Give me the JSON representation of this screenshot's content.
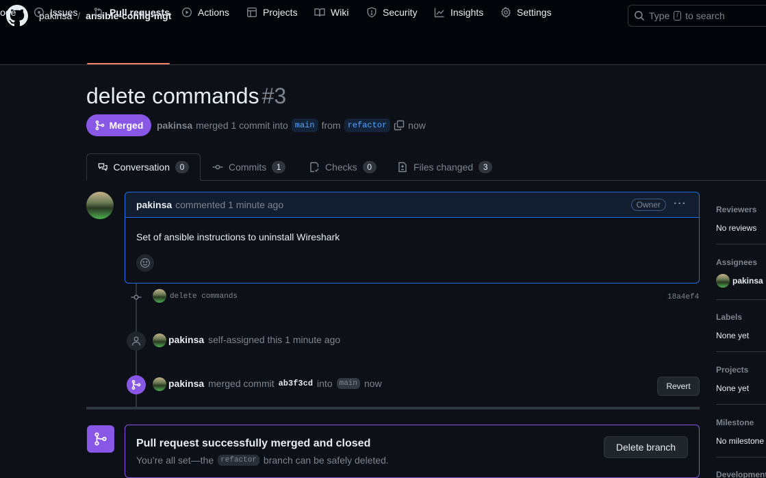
{
  "repo": {
    "owner": "pakinsa",
    "name": "ansible-config-mgt"
  },
  "search": {
    "prefix": "Type",
    "key": "/",
    "suffix": "to search"
  },
  "nav": [
    {
      "label": "Code",
      "icon": "code-icon"
    },
    {
      "label": "Issues",
      "icon": "issue-icon"
    },
    {
      "label": "Pull requests",
      "icon": "pull-request-icon"
    },
    {
      "label": "Actions",
      "icon": "play-icon"
    },
    {
      "label": "Projects",
      "icon": "table-icon"
    },
    {
      "label": "Wiki",
      "icon": "book-icon"
    },
    {
      "label": "Security",
      "icon": "shield-icon"
    },
    {
      "label": "Insights",
      "icon": "graph-icon"
    },
    {
      "label": "Settings",
      "icon": "gear-icon"
    }
  ],
  "pr": {
    "title": "delete commands",
    "number": "#3",
    "state": "Merged",
    "meta": {
      "author": "pakinsa",
      "verb": "merged 1 commit into",
      "base": "main",
      "from": "from",
      "head": "refactor",
      "time": "now"
    }
  },
  "tabs": [
    {
      "label": "Conversation",
      "count": "0"
    },
    {
      "label": "Commits",
      "count": "1"
    },
    {
      "label": "Checks",
      "count": "0"
    },
    {
      "label": "Files changed",
      "count": "3"
    }
  ],
  "comment": {
    "author": "pakinsa",
    "action": "commented 1 minute ago",
    "role": "Owner",
    "body": "Set of ansible instructions to uninstall Wireshark"
  },
  "timeline": {
    "commit": {
      "message": "delete commands",
      "sha": "18a4ef4"
    },
    "assign": {
      "user": "pakinsa",
      "text": "self-assigned this 1 minute ago"
    },
    "merge": {
      "user": "pakinsa",
      "verb": "merged commit",
      "sha": "ab3f3cd",
      "into": "into",
      "base": "main",
      "time": "now",
      "revert": "Revert"
    }
  },
  "merged_box": {
    "title": "Pull request successfully merged and closed",
    "sub_before": "You’re all set—the",
    "branch": "refactor",
    "sub_after": "branch can be safely deleted.",
    "delete_label": "Delete branch"
  },
  "sidebar": [
    {
      "label": "Reviewers",
      "value": "No reviews"
    },
    {
      "label": "Assignees",
      "value": "pakinsa"
    },
    {
      "label": "Labels",
      "value": "None yet"
    },
    {
      "label": "Projects",
      "value": "None yet"
    },
    {
      "label": "Milestone",
      "value": "No milestone"
    },
    {
      "label": "Development",
      "value": ""
    }
  ],
  "colors": {
    "merged": "#8957e5",
    "accent": "#1f6feb",
    "underline": "#f78166"
  }
}
